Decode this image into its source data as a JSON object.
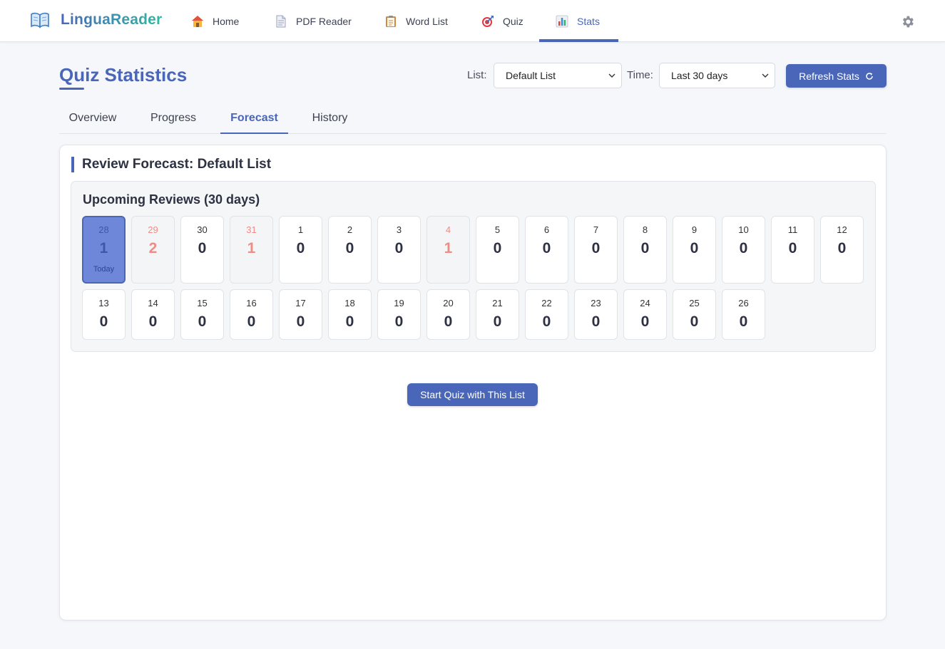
{
  "brand": {
    "name": "LinguaReader",
    "icon": "open-book-icon"
  },
  "nav": {
    "items": [
      {
        "label": "Home",
        "icon": "house-icon"
      },
      {
        "label": "PDF Reader",
        "icon": "document-icon"
      },
      {
        "label": "Word List",
        "icon": "clipboard-icon"
      },
      {
        "label": "Quiz",
        "icon": "target-icon"
      },
      {
        "label": "Stats",
        "icon": "bar-chart-icon",
        "active": true
      }
    ],
    "settings_icon": "gear-icon"
  },
  "header": {
    "title": "Quiz Statistics",
    "list_label": "List:",
    "list_value": "Default List",
    "time_label": "Time:",
    "time_value": "Last 30 days",
    "refresh_label": "Refresh Stats"
  },
  "tabs": [
    {
      "label": "Overview"
    },
    {
      "label": "Progress"
    },
    {
      "label": "Forecast",
      "active": true
    },
    {
      "label": "History"
    }
  ],
  "forecast": {
    "card_title": "Review Forecast: Default List",
    "section_title": "Upcoming Reviews (30 days)",
    "today_label": "Today",
    "days": [
      {
        "date": "28",
        "count": "1",
        "today": true
      },
      {
        "date": "29",
        "count": "2",
        "due": true
      },
      {
        "date": "30",
        "count": "0"
      },
      {
        "date": "31",
        "count": "1",
        "due": true
      },
      {
        "date": "1",
        "count": "0"
      },
      {
        "date": "2",
        "count": "0"
      },
      {
        "date": "3",
        "count": "0"
      },
      {
        "date": "4",
        "count": "1",
        "due": true
      },
      {
        "date": "5",
        "count": "0"
      },
      {
        "date": "6",
        "count": "0"
      },
      {
        "date": "7",
        "count": "0"
      },
      {
        "date": "8",
        "count": "0"
      },
      {
        "date": "9",
        "count": "0"
      },
      {
        "date": "10",
        "count": "0"
      },
      {
        "date": "11",
        "count": "0"
      },
      {
        "date": "12",
        "count": "0"
      },
      {
        "date": "13",
        "count": "0"
      },
      {
        "date": "14",
        "count": "0"
      },
      {
        "date": "15",
        "count": "0"
      },
      {
        "date": "16",
        "count": "0"
      },
      {
        "date": "17",
        "count": "0"
      },
      {
        "date": "18",
        "count": "0"
      },
      {
        "date": "19",
        "count": "0"
      },
      {
        "date": "20",
        "count": "0"
      },
      {
        "date": "21",
        "count": "0"
      },
      {
        "date": "22",
        "count": "0"
      },
      {
        "date": "23",
        "count": "0"
      },
      {
        "date": "24",
        "count": "0"
      },
      {
        "date": "25",
        "count": "0"
      },
      {
        "date": "26",
        "count": "0"
      }
    ],
    "start_quiz_label": "Start Quiz with This List"
  },
  "colors": {
    "accent": "#4a66b8",
    "due": "#ef8c86",
    "today_bg": "#6e87d8",
    "background": "#f5f7fa"
  }
}
